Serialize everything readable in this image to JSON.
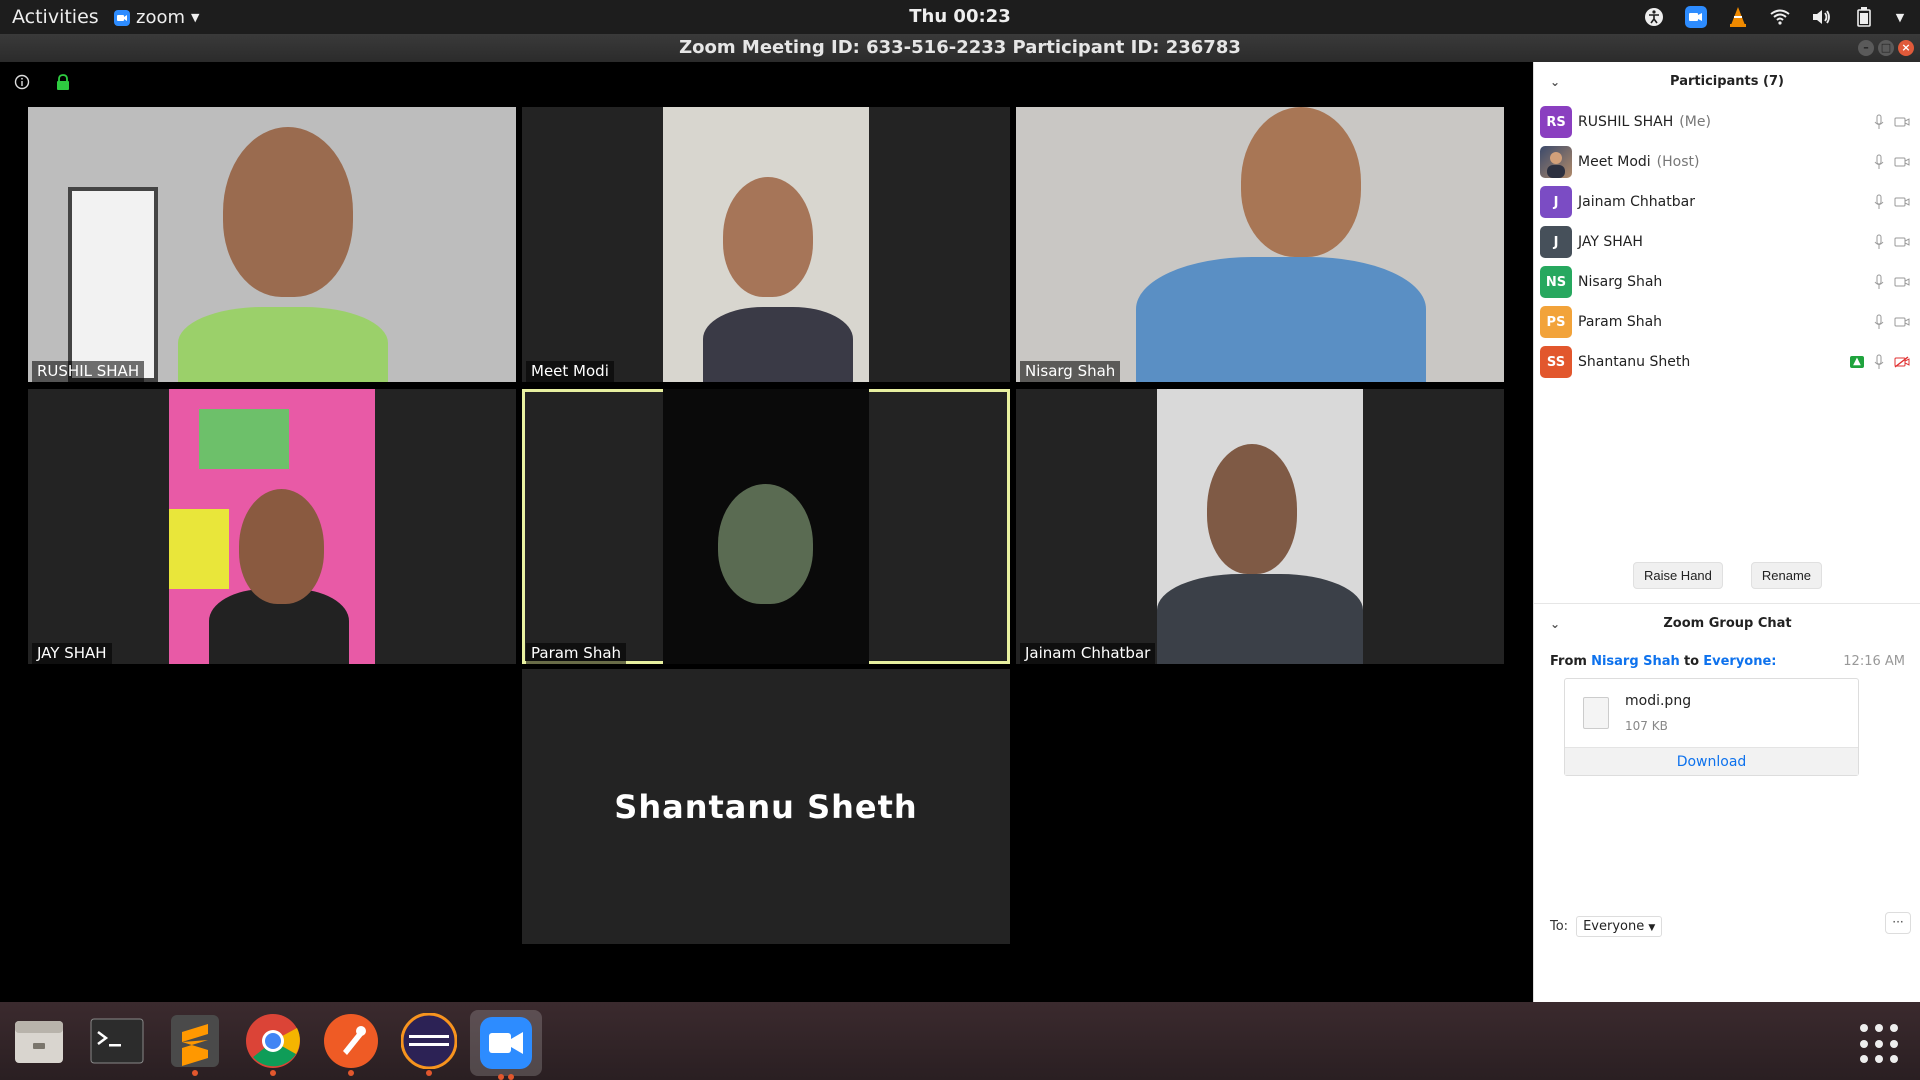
{
  "topbar": {
    "activities": "Activities",
    "app_name": "zoom",
    "clock": "Thu 00:23"
  },
  "window": {
    "title": "Zoom Meeting ID: 633-516-2233 Participant ID: 236783"
  },
  "video_tiles": [
    {
      "name": "RUSHIL SHAH",
      "bg": "#bdbdbd"
    },
    {
      "name": "Meet Modi",
      "bg": "#d8d6cf"
    },
    {
      "name": "Nisarg Shah",
      "bg": "#c9c7c4"
    },
    {
      "name": "JAY SHAH",
      "bg": "#e85aa6"
    },
    {
      "name": "Param Shah",
      "bg": "#0a0a0a",
      "active": true
    },
    {
      "name": "Jainam Chhatbar",
      "bg": "#d9d9d9"
    }
  ],
  "no_video_tile": {
    "name": "Shantanu Sheth"
  },
  "participants_panel": {
    "title": "Participants (7)",
    "participants": [
      {
        "initials": "RS",
        "name": "RUSHIL SHAH",
        "role": "(Me)",
        "color": "#8a3fc0"
      },
      {
        "initials": "",
        "name": "Meet Modi",
        "role": "(Host)",
        "color": "#3b4a6b"
      },
      {
        "initials": "J",
        "name": "Jainam Chhatbar",
        "role": "",
        "color": "#7b4cc4"
      },
      {
        "initials": "J",
        "name": "JAY SHAH",
        "role": "",
        "color": "#46505a"
      },
      {
        "initials": "NS",
        "name": "Nisarg Shah",
        "role": "",
        "color": "#27a85f"
      },
      {
        "initials": "PS",
        "name": "Param Shah",
        "role": "",
        "color": "#f2a33a"
      },
      {
        "initials": "SS",
        "name": "Shantanu Sheth",
        "role": "",
        "color": "#e2572d"
      }
    ],
    "raise_hand": "Raise Hand",
    "rename": "Rename"
  },
  "chat": {
    "title": "Zoom Group Chat",
    "from_label": "From",
    "sender": "Nisarg Shah",
    "to_label": "to",
    "recipient": "Everyone:",
    "time": "12:16 AM",
    "file_name": "modi.png",
    "file_size": "107 KB",
    "download": "Download",
    "to_prefix": "To:",
    "to_value": "Everyone",
    "more": "···"
  },
  "colors": {
    "accent": "#0e72ed",
    "active_speaker": "#e8f0a0"
  }
}
